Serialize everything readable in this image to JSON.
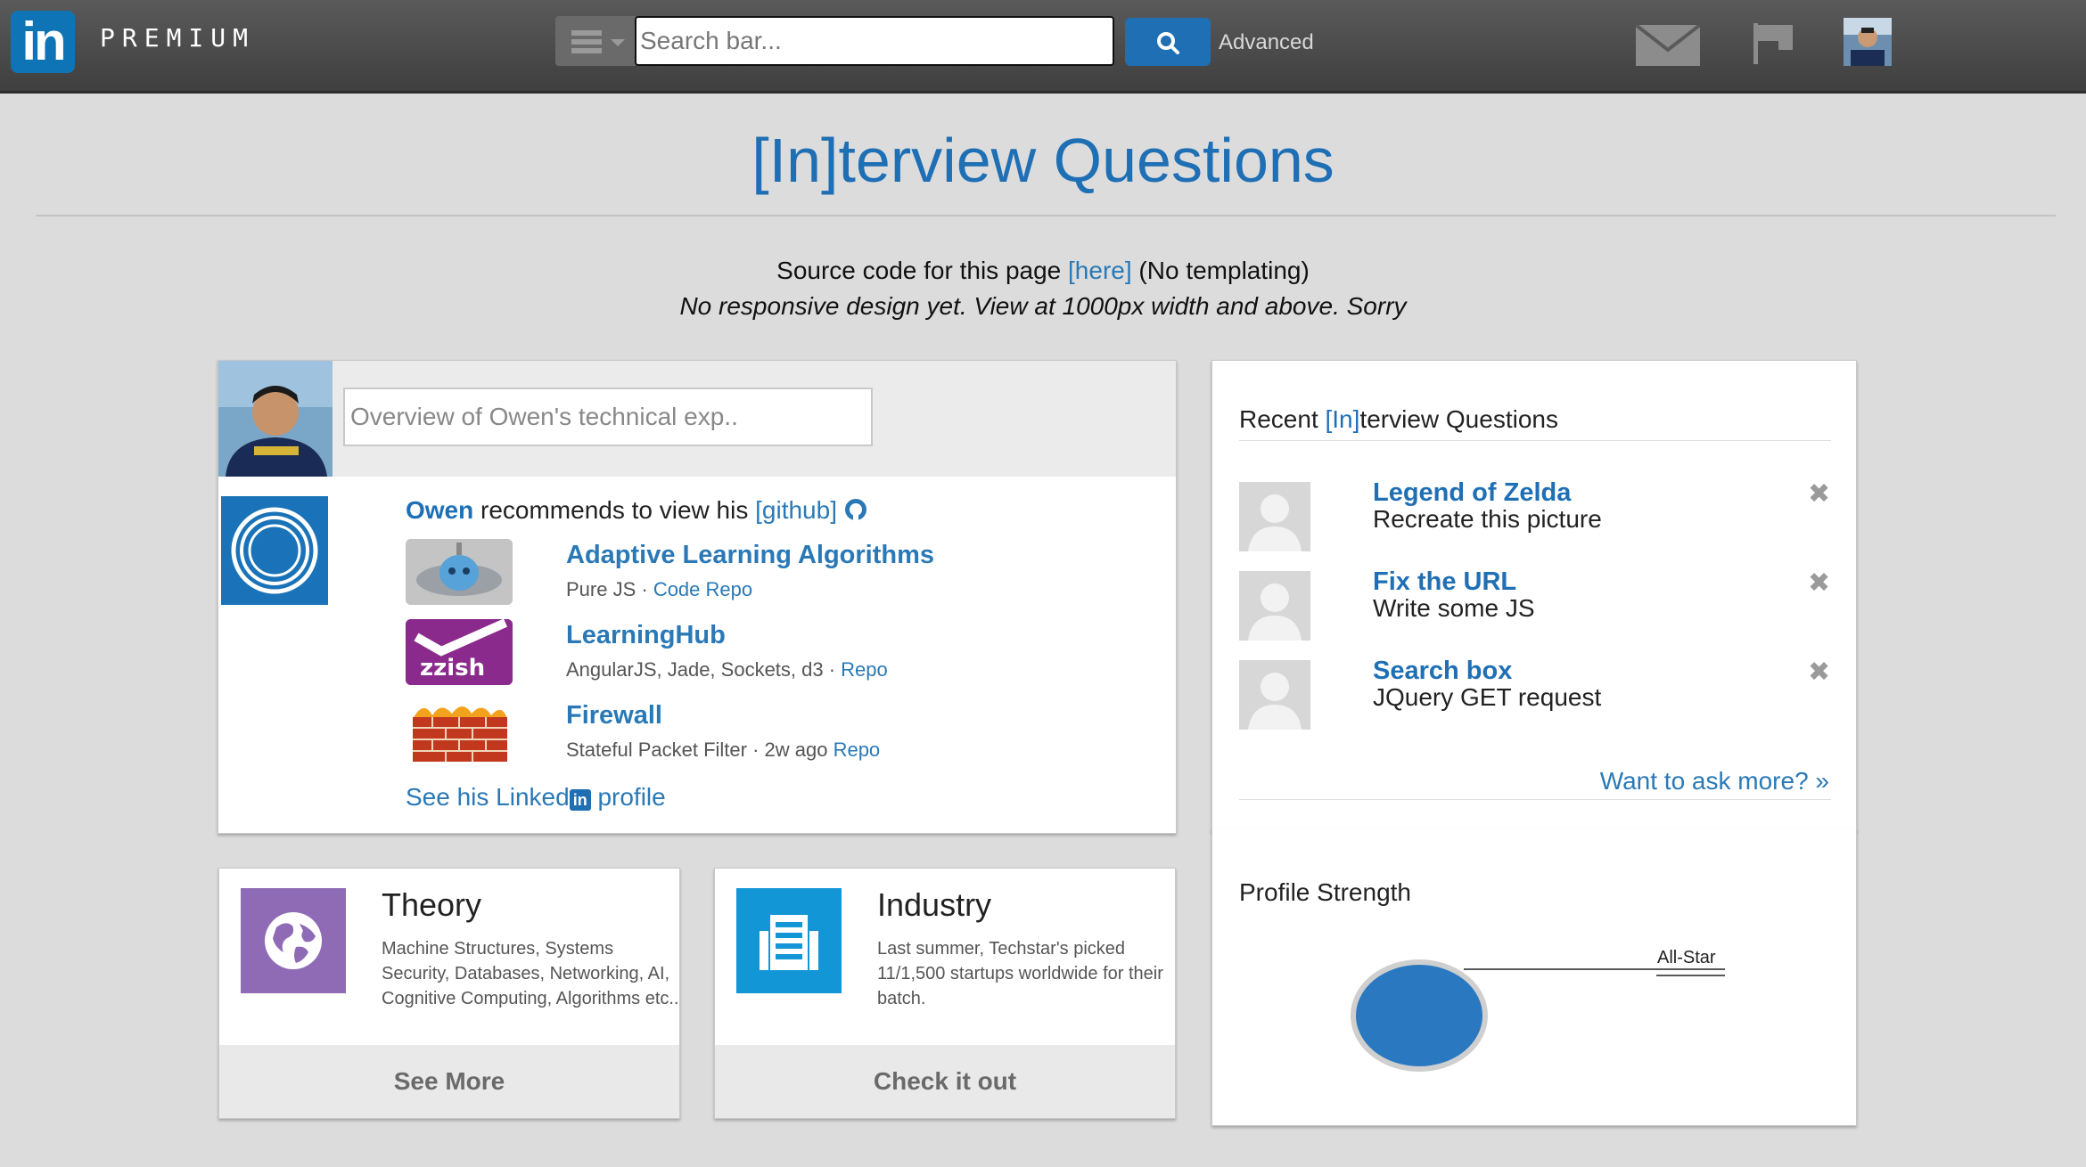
{
  "topbar": {
    "logo_text": "in",
    "brand_label": "PREMIUM",
    "search_placeholder": "Search bar...",
    "advanced_label": "Advanced"
  },
  "page": {
    "title": "[In]terview Questions",
    "source_prefix": "Source code for this page ",
    "source_link": "[here]",
    "source_suffix": " (No templating)",
    "note": "No responsive design yet. View at 1000px width and above. Sorry"
  },
  "profile_card": {
    "overview_placeholder": "Overview of Owen's technical exp..",
    "recommend_name": "Owen",
    "recommend_text": " recommends to view his ",
    "github_link": "[github]",
    "repos": [
      {
        "title": "Adaptive Learning Algorithms",
        "sub": "Pure JS · ",
        "link": "Code Repo"
      },
      {
        "title": "LearningHub",
        "sub": "AngularJS, Jade, Sockets, d3 · ",
        "link": "Repo"
      },
      {
        "title": "Firewall",
        "sub": "Stateful Packet Filter · 2w ago ",
        "link": "Repo"
      }
    ],
    "zzish_label": "zzish",
    "see_profile_prefix": "See his Linked",
    "see_profile_in": "in",
    "see_profile_suffix": " profile"
  },
  "recent": {
    "title_prefix": "Recent ",
    "title_highlight": "[In]",
    "title_suffix": "terview Questions",
    "items": [
      {
        "title": "Legend of Zelda",
        "sub": "Recreate this picture"
      },
      {
        "title": "Fix the URL",
        "sub": "Write some JS"
      },
      {
        "title": "Search box",
        "sub": "JQuery GET request"
      }
    ],
    "close_glyph": "✖",
    "ask_more": "Want to ask more? »"
  },
  "tiles": {
    "theory": {
      "title": "Theory",
      "desc": "Machine Structures, Systems Security, Databases, Networking, AI, Cognitive Computing, Algorithms etc..",
      "footer": "See More",
      "color": "#8e6bb4"
    },
    "industry": {
      "title": "Industry",
      "desc": "Last summer, Techstar's picked 11/1,500 startups worldwide for their batch.",
      "footer": "Check it out",
      "color": "#1296d6"
    }
  },
  "strength": {
    "title": "Profile Strength",
    "level": "All-Star",
    "color": "#2a79c0"
  },
  "colors": {
    "brand_blue": "#1f6fb5",
    "link_blue": "#2a79b6",
    "background": "#dcdcdc"
  }
}
